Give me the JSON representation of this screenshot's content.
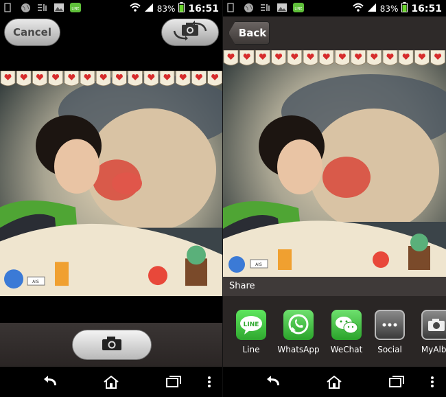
{
  "status": {
    "battery": "83%",
    "time": "16:51",
    "line_badge": "LINE"
  },
  "camera": {
    "cancel_label": "Cancel"
  },
  "share_screen": {
    "back_label": "Back",
    "share_title": "Share",
    "targets": [
      {
        "label": "Line",
        "icon_text": "LINE"
      },
      {
        "label": "WhatsApp"
      },
      {
        "label": "WeChat"
      },
      {
        "label": "Social"
      },
      {
        "label": "MyAlbu"
      }
    ]
  },
  "colors": {
    "line_green": "#3ac43a",
    "bar_brown": "#2e2a29",
    "heart_red": "#d62c2c"
  },
  "sticker_text": "AIS"
}
